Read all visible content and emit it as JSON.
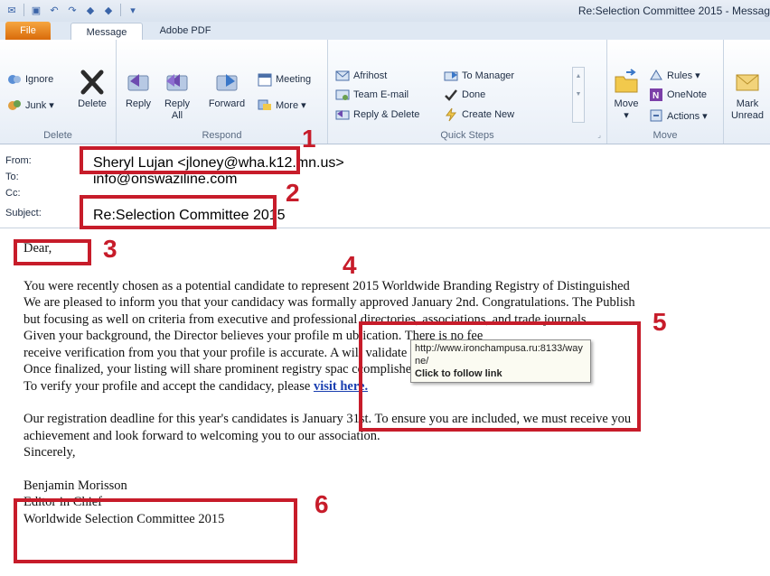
{
  "window": {
    "title": "Re:Selection Committee 2015 - Messag"
  },
  "tabs": {
    "file": "File",
    "message": "Message",
    "adobe": "Adobe PDF"
  },
  "ribbon": {
    "delete_group": {
      "label": "Delete",
      "ignore": "Ignore",
      "junk": "Junk ▾",
      "delete": "Delete"
    },
    "respond_group": {
      "label": "Respond",
      "reply": "Reply",
      "reply_all_line1": "Reply",
      "reply_all_line2": "All",
      "forward": "Forward",
      "meeting": "Meeting",
      "more": "More ▾"
    },
    "quick_steps": {
      "label": "Quick Steps",
      "afrihost": "Afrihost",
      "team_email": "Team E-mail",
      "reply_delete": "Reply & Delete",
      "to_manager": "To Manager",
      "done": "Done",
      "create_new": "Create New"
    },
    "move_group": {
      "label": "Move",
      "move": "Move",
      "move_arrow": "▾",
      "rules": "Rules ▾",
      "onenote": "OneNote",
      "actions": "Actions ▾"
    },
    "tags": {
      "mark_line1": "Mark",
      "mark_line2": "Unread"
    }
  },
  "header": {
    "from_label": "From:",
    "from_value": "Sheryl Lujan <jloney@wha.k12.mn.us>",
    "to_label": "To:",
    "to_value": "info@onswaziline.com",
    "cc_label": "Cc:",
    "cc_value": "",
    "subject_label": "Subject:",
    "subject_value": "Re:Selection Committee 2015"
  },
  "body": {
    "greeting": "Dear,",
    "p1": [
      "You were recently chosen as a potential candidate to represent 2015 Worldwide Branding Registry of Distinguished",
      "We are pleased to inform you that your candidacy was formally approved January 2nd. Congratulations. The Publish",
      "but focusing as well on criteria from executive and professional directories, associations, and trade journals.",
      "Given your background, the Director believes your profile m                                    ublication. There is no fee",
      "receive verification from you that your profile is accurate. A                                    will validate your registry",
      "Once finalized, your listing will share prominent registry spac                                    ccomplished individuals a"
    ],
    "verify_text": "To verify your profile and accept the candidacy, please ",
    "link_text": "visit here.",
    "p2": [
      "Our registration deadline for this year's candidates is January 31st. To ensure you are included, we must receive you",
      "achievement and look forward to welcoming you to our association.",
      "Sincerely,"
    ],
    "signature": [
      "Benjamin Morisson",
      "Editor in Chief",
      "Worldwide Selection Committee 2015"
    ]
  },
  "tooltip": {
    "url": "http://www.ironchampusa.ru:8133/wayne/",
    "hint": "Click to follow link"
  },
  "annotations": [
    "1",
    "2",
    "3",
    "4",
    "5",
    "6"
  ],
  "colors": {
    "annotation": "#c71c2a",
    "link": "#1a3fb0"
  }
}
